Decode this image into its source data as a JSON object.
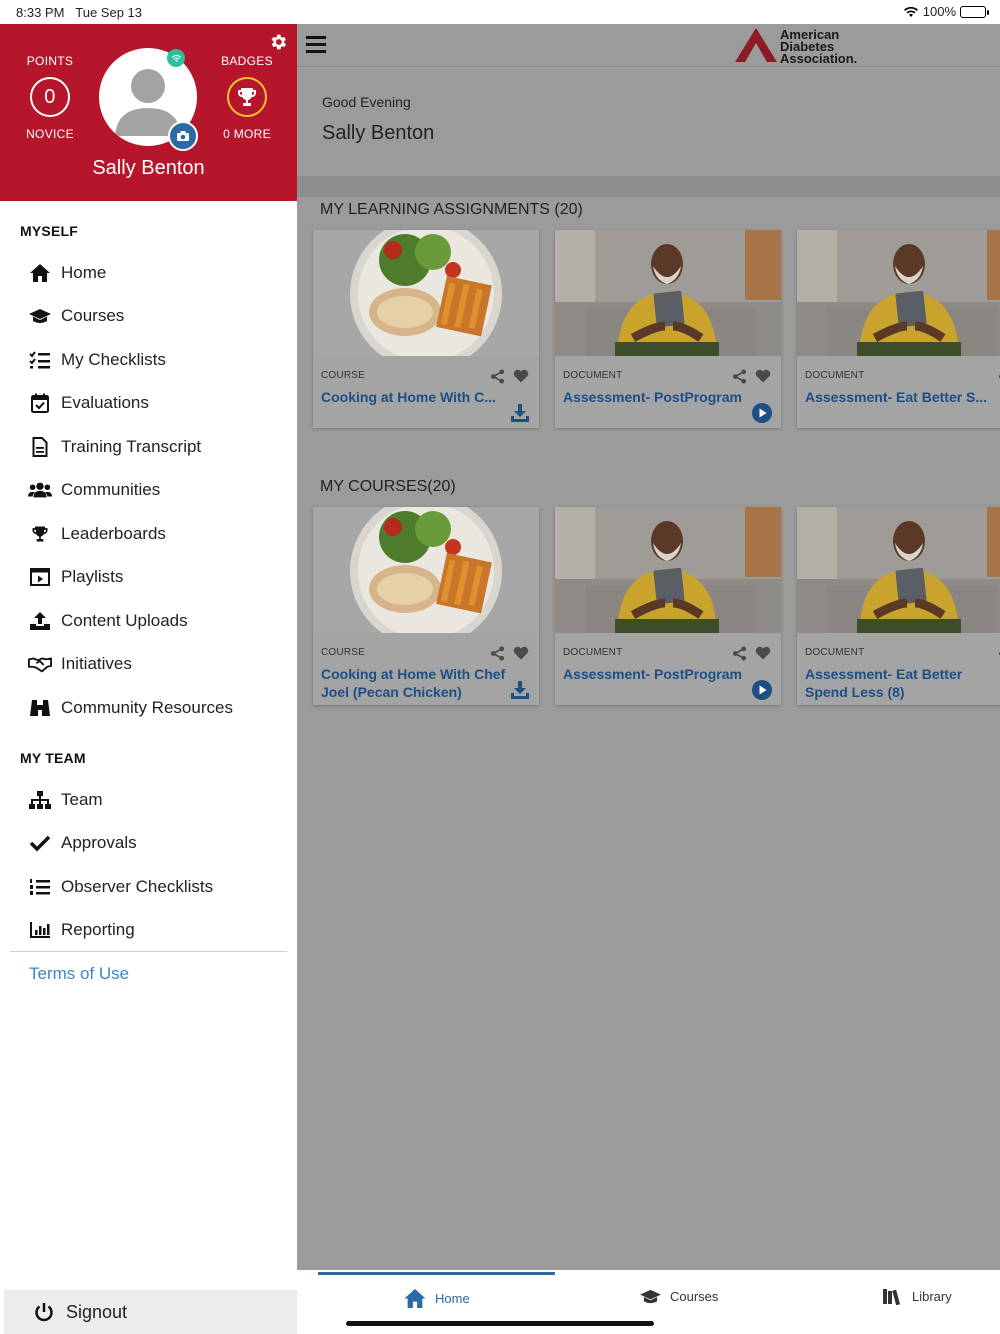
{
  "status": {
    "time": "8:33 PM",
    "date": "Tue Sep 13",
    "battery": "100%"
  },
  "profile": {
    "points_label": "POINTS",
    "points_value": "0",
    "level": "NOVICE",
    "badges_label": "BADGES",
    "badges_more": "0 MORE",
    "name": "Sally Benton",
    "accent": "#b5162b"
  },
  "drawer": {
    "myself_header": "MYSELF",
    "myself_items": [
      {
        "label": "Home",
        "icon": "home-icon"
      },
      {
        "label": "Courses",
        "icon": "graduation-cap-icon"
      },
      {
        "label": "My Checklists",
        "icon": "checklist-icon"
      },
      {
        "label": "Evaluations",
        "icon": "calendar-check-icon"
      },
      {
        "label": "Training Transcript",
        "icon": "document-icon"
      },
      {
        "label": "Communities",
        "icon": "users-icon"
      },
      {
        "label": "Leaderboards",
        "icon": "trophy-icon"
      },
      {
        "label": "Playlists",
        "icon": "playlist-icon"
      },
      {
        "label": "Content Uploads",
        "icon": "upload-icon"
      },
      {
        "label": "Initiatives",
        "icon": "handshake-icon"
      },
      {
        "label": "Community Resources",
        "icon": "binoculars-icon"
      }
    ],
    "team_header": "MY TEAM",
    "team_items": [
      {
        "label": "Team",
        "icon": "org-chart-icon"
      },
      {
        "label": "Approvals",
        "icon": "checkmark-icon"
      },
      {
        "label": "Observer Checklists",
        "icon": "numbered-list-icon"
      },
      {
        "label": "Reporting",
        "icon": "bar-chart-icon"
      }
    ],
    "terms": "Terms of Use",
    "signout": "Signout"
  },
  "header": {
    "logo_line1": "American",
    "logo_line2": "Diabetes",
    "logo_line3": "Association."
  },
  "greeting": {
    "salutation": "Good Evening",
    "name": "Sally Benton"
  },
  "assignments": {
    "title": "MY LEARNING ASSIGNMENTS (20)",
    "cards": [
      {
        "type": "COURSE",
        "title": "Cooking at Home With C...",
        "image": "salad-image",
        "action": "download-icon"
      },
      {
        "type": "DOCUMENT",
        "title": "Assessment- PostProgram",
        "image": "man-tablet-image",
        "action": "play-icon"
      },
      {
        "type": "DOCUMENT",
        "title": "Assessment- Eat Better S...",
        "image": "man-tablet-image",
        "action": "play-icon"
      }
    ]
  },
  "courses": {
    "title": "MY COURSES(20)",
    "cards": [
      {
        "type": "COURSE",
        "title": "Cooking at Home With Chef Joel (Pecan Chicken)",
        "image": "salad-image",
        "action": "download-icon"
      },
      {
        "type": "DOCUMENT",
        "title": "Assessment- PostProgram",
        "image": "man-tablet-image",
        "action": "play-icon"
      },
      {
        "type": "DOCUMENT",
        "title": "Assessment- Eat Better Spend Less (8)",
        "image": "man-tablet-image",
        "action": "play-icon"
      }
    ]
  },
  "tabs": [
    {
      "label": "Home",
      "icon": "home-icon"
    },
    {
      "label": "Courses",
      "icon": "graduation-cap-icon"
    },
    {
      "label": "Library",
      "icon": "library-icon"
    }
  ]
}
